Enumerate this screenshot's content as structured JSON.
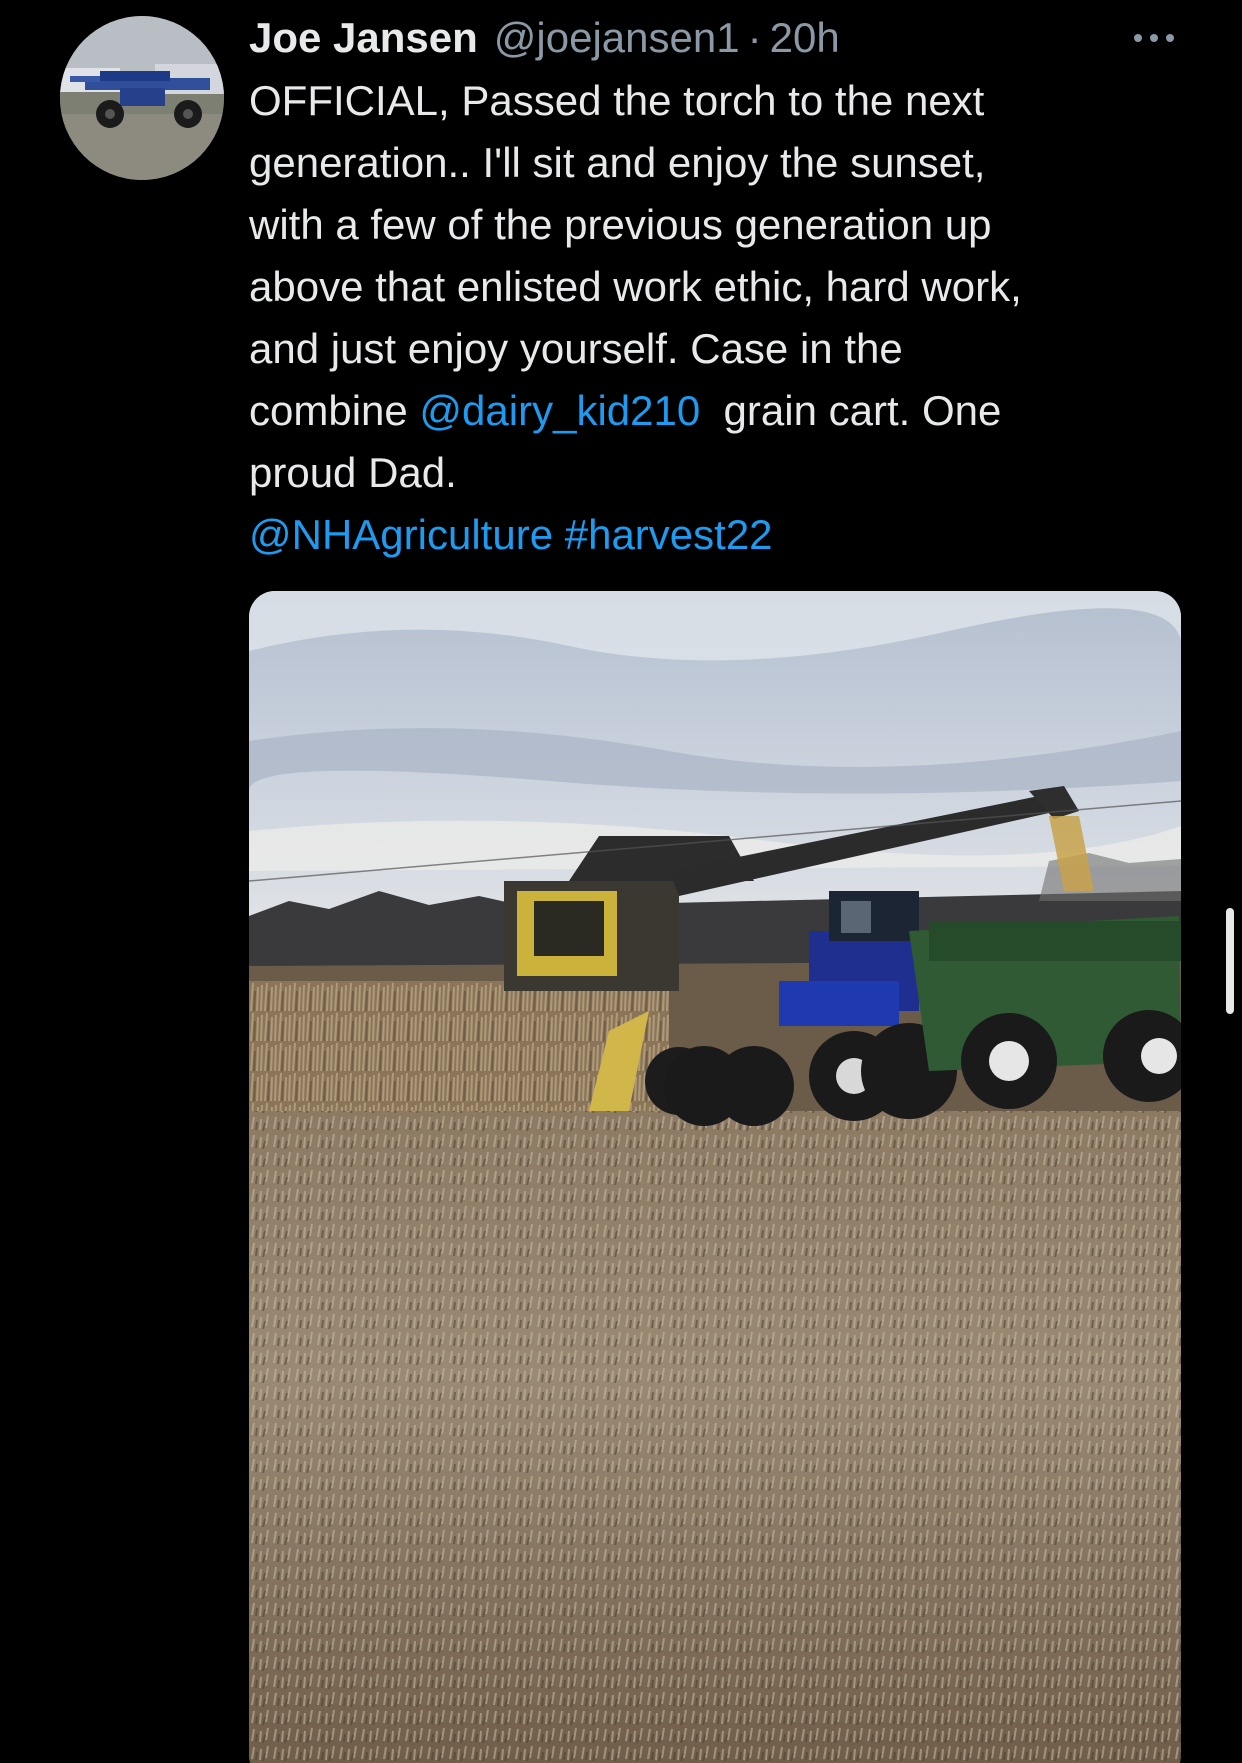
{
  "author": {
    "display_name": "Joe Jansen",
    "handle": "@joejansen1",
    "separator": "·",
    "time": "20h",
    "avatar_icon": "profile-avatar-sprayer-photo"
  },
  "menu": {
    "more_icon": "more-horizontal-icon"
  },
  "tweet": {
    "line1": "OFFICIAL, Passed the torch to the next",
    "line2": "generation.. I'll sit and enjoy the sunset,",
    "line3": "with a few of the previous generation up",
    "line4": "above that enlisted work ethic, hard work,",
    "line5": "and just enjoy yourself. Case in the",
    "line6_before": "combine ",
    "mention1": "@dairy_kid210",
    "line6_after": "  grain cart. One",
    "line7": "proud Dad.",
    "mention2": "@NHAgriculture",
    "hashtag": "#harvest22"
  },
  "media": {
    "description": "harvest-photo"
  },
  "colors": {
    "background": "#000000",
    "text": "#e7e9ea",
    "secondary": "#8b98a5",
    "link": "#1d9bf0"
  }
}
